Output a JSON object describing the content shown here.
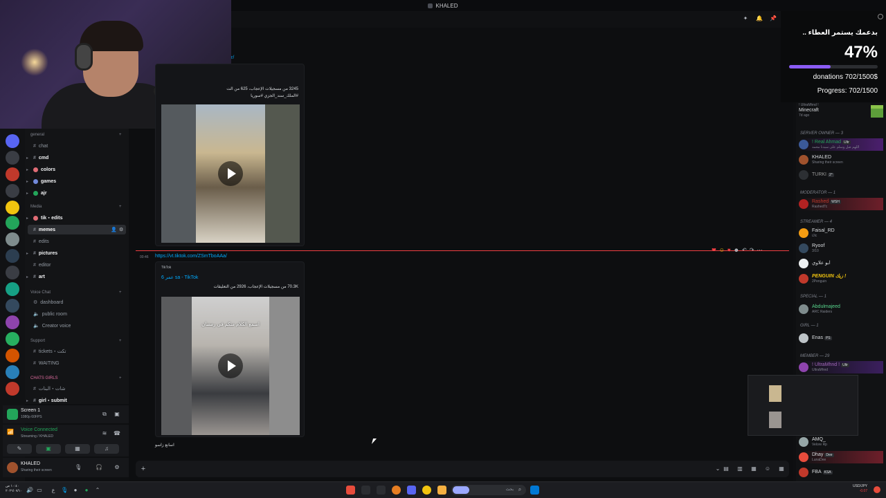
{
  "window": {
    "title": "KHALED"
  },
  "colors": {
    "accent": "#5865f2",
    "progress": "#8b5cf6",
    "danger": "#f23f43",
    "online": "#23a55a",
    "link": "#00a8fc"
  },
  "donation": {
    "header": "بدعمك يستمر العطاء ..",
    "percent_label": "47%",
    "progress_fraction": 0.47,
    "donations_text": "donations 702/1500$",
    "progress_text": "Progress: 702/1500"
  },
  "channels": {
    "categories": [
      {
        "label": "general",
        "items": [
          {
            "label": "chat",
            "icon": "chat-icon",
            "unread": false
          },
          {
            "label": "cmd",
            "icon": "command-icon",
            "unread": true
          },
          {
            "label": "colors",
            "icon": "palette-icon",
            "unread": true
          },
          {
            "label": "games",
            "icon": "gamepad-icon",
            "unread": true
          },
          {
            "label": "ajr",
            "icon": "leaf-icon",
            "unread": true
          }
        ]
      },
      {
        "label": "Media",
        "items": [
          {
            "label": "tik・edits",
            "icon": "tiktok-icon",
            "unread": true
          },
          {
            "label": "memes",
            "icon": "smile-icon",
            "unread": true,
            "active": true
          },
          {
            "label": "edits",
            "icon": "film-icon",
            "unread": false
          },
          {
            "label": "pictures",
            "icon": "image-icon",
            "unread": true
          },
          {
            "label": "editor",
            "icon": "pen-icon",
            "unread": false
          },
          {
            "label": "art",
            "icon": "brush-icon",
            "unread": true
          }
        ]
      },
      {
        "label": "Voice Chat",
        "items": [
          {
            "label": "dashboard",
            "icon": "gear-icon",
            "unread": false
          },
          {
            "label": "public room",
            "icon": "speaker-icon",
            "unread": false
          },
          {
            "label": "Creator voice",
            "icon": "speaker-icon",
            "unread": false
          }
        ]
      },
      {
        "label": "Support",
        "items": [
          {
            "label": "tickets・تكت",
            "icon": "ticket-icon",
            "unread": false
          },
          {
            "label": "WAITING",
            "icon": "clock-icon",
            "unread": false
          }
        ]
      },
      {
        "label": "CHATS GIRLS",
        "items": [
          {
            "label": "شات・البنات",
            "icon": "heart-icon",
            "unread": false
          },
          {
            "label": "girl・submit",
            "icon": "heart-icon",
            "unread": true
          }
        ]
      }
    ]
  },
  "screen_panel": {
    "title": "Screen 1",
    "sub": "1080p 60FPS"
  },
  "voice_panel": {
    "status": "Voice Connected",
    "sub": "Streaming / KHALED"
  },
  "user_panel": {
    "name": "KHALED",
    "status": "Sharing their screen"
  },
  "messages": [
    {
      "link_partial": "r/",
      "embed_desc": "3245 من مسجيلات الإعجاب، 625 من الت",
      "embed_tags": "#الملك_سند_الجزي #سوريا",
      "video": "video-palm-tree"
    },
    {
      "time": "00:46",
      "link": "https://vt.tiktok.com/ZSmTboAAa/",
      "provider": "TikTok",
      "author": "عمر 6 sa - TikTok",
      "embed_desc": "70.3K من مسجيلات الإعجاب، 2926 من التعليقات",
      "video_caption": "اسمع الكلام منكم في رمضان",
      "video": "video-hand"
    }
  ],
  "composer_text": "اسانع زاسو",
  "members": {
    "top_entry": {
      "name": "! UltraMhnd !",
      "activity": "Minecraft",
      "time": "7d ago"
    },
    "groups": [
      {
        "label": "SERVER OWNER — 3",
        "items": [
          {
            "name": "! Real Ahmad",
            "badge": "Ultr",
            "sub": "اللهم صل وسلم على سيدنا محمد"
          },
          {
            "name": "KHALED",
            "badge": "",
            "sub": "Sharing their screen"
          },
          {
            "name": "TURKI",
            "badge": "2°",
            "sub": ""
          }
        ]
      },
      {
        "label": "MODERATOR — 1",
        "items": [
          {
            "name": "Rashed",
            "badge": "WSH",
            "sub": "RashedTc"
          }
        ]
      },
      {
        "label": "STREAMER — 4",
        "items": [
          {
            "name": "Faisal_RD",
            "badge": "",
            "sub": "iJic"
          },
          {
            "name": "Ryoof",
            "badge": "",
            "sub": "3/10"
          },
          {
            "name": "ابو علاوي",
            "badge": "",
            "sub": ""
          },
          {
            "name": "PENGUIN زيك !",
            "badge": "",
            "sub": "2Penguin"
          }
        ]
      },
      {
        "label": "SPECIAL — 1",
        "items": [
          {
            "name": "Abdulmajeed",
            "badge": "",
            "sub": "ARC Raiders"
          }
        ]
      },
      {
        "label": "girl — 1",
        "items": [
          {
            "name": "Enas",
            "badge": "PS",
            "sub": ""
          }
        ]
      },
      {
        "label": "MEMBER — 29",
        "items": [
          {
            "name": "! UltraMhnd !",
            "badge": "Ultr",
            "sub": "UltraMhnd"
          }
        ]
      }
    ],
    "bottom": [
      {
        "name": "AMQ_",
        "badge": "",
        "sub": "Velore Rp"
      },
      {
        "name": "Dhay",
        "badge": "Dee",
        "sub": "LunaDee"
      },
      {
        "name": "FBA",
        "badge": "KSA",
        "sub": ""
      }
    ]
  },
  "taskbar": {
    "left_time": "١٠:٤٠ ص",
    "left_date": "٢٠٢٦/٠٧/١٠",
    "search_placeholder": "بحث",
    "currency": "USD/JPY",
    "currency_sub": "-0.07"
  }
}
